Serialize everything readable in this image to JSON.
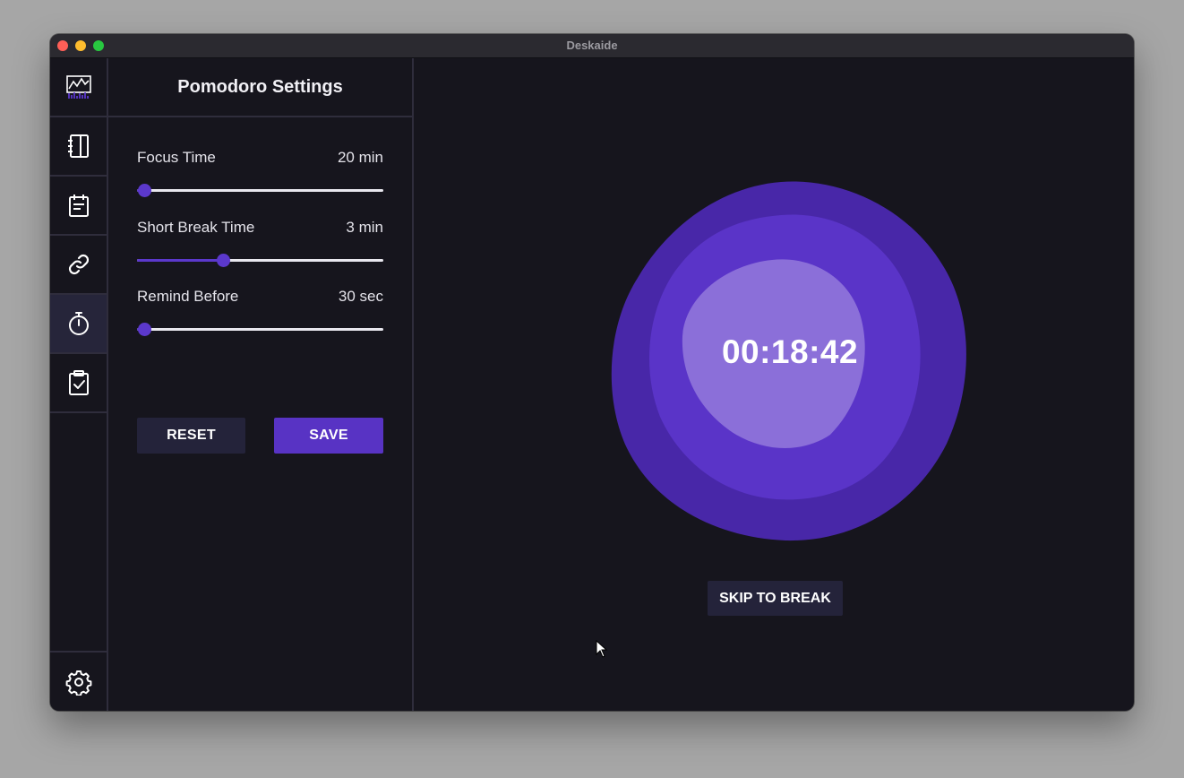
{
  "window": {
    "title": "Deskaide"
  },
  "sidebar": {
    "items": [
      {
        "icon": "analytics-chart-icon",
        "active": false
      },
      {
        "icon": "notebook-icon",
        "active": false
      },
      {
        "icon": "calendar-icon",
        "active": false
      },
      {
        "icon": "link-icon",
        "active": false
      },
      {
        "icon": "stopwatch-icon",
        "active": true
      },
      {
        "icon": "clipboard-check-icon",
        "active": false
      }
    ],
    "settings_icon": "gear-icon"
  },
  "settings": {
    "title": "Pomodoro Settings",
    "focus": {
      "label": "Focus Time",
      "value": "20 min",
      "fraction": 0.0
    },
    "short_break": {
      "label": "Short Break Time",
      "value": "3 min",
      "fraction": 0.34
    },
    "remind": {
      "label": "Remind Before",
      "value": "30 sec",
      "fraction": 0.0
    },
    "reset_label": "RESET",
    "save_label": "SAVE"
  },
  "timer": {
    "display": "00:18:42",
    "skip_label": "SKIP TO BREAK"
  },
  "colors": {
    "accent": "#5833c4",
    "blob_outer": "#4827a8",
    "blob_middle": "#5a34c8",
    "blob_inner": "#8b6fd9",
    "background": "#16151d"
  }
}
